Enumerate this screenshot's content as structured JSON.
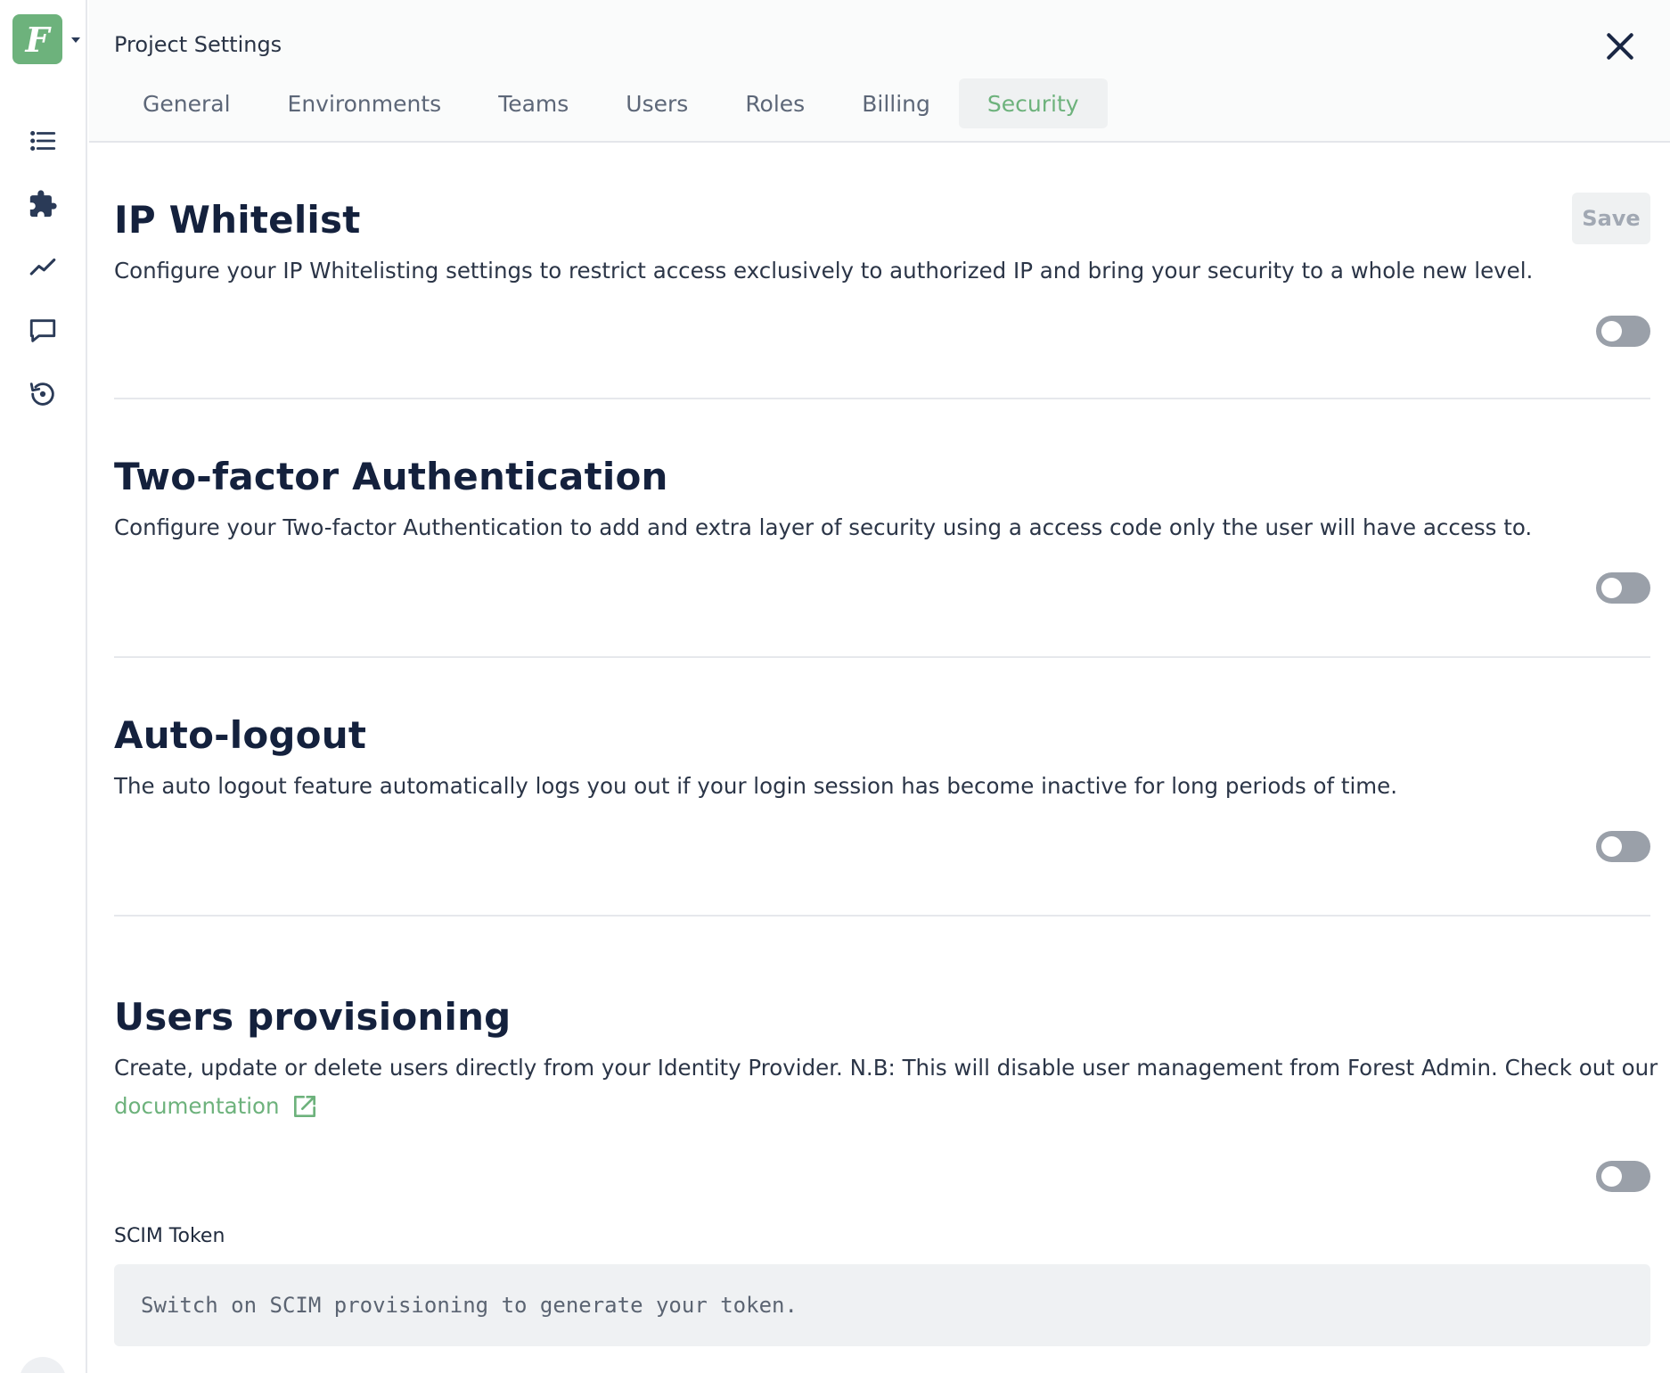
{
  "app": {
    "logo_letter": "F",
    "brand_color": "#6db27c",
    "header_title": "Project Settings"
  },
  "rail": {
    "icons": [
      "list-icon",
      "puzzle-icon",
      "analytics-icon",
      "chat-icon",
      "history-icon"
    ]
  },
  "tabs": [
    {
      "label": "General",
      "active": false
    },
    {
      "label": "Environments",
      "active": false
    },
    {
      "label": "Teams",
      "active": false
    },
    {
      "label": "Users",
      "active": false
    },
    {
      "label": "Roles",
      "active": false
    },
    {
      "label": "Billing",
      "active": false
    },
    {
      "label": "Security",
      "active": true
    }
  ],
  "save_label": "Save",
  "sections": {
    "ip_whitelist": {
      "title": "IP Whitelist",
      "description": "Configure your IP Whitelisting settings to restrict access exclusively to authorized IP and bring your security to a whole new level.",
      "enabled": false
    },
    "two_factor": {
      "title": "Two-factor Authentication",
      "description": "Configure your Two-factor Authentication to add and extra layer of security using a access code only the user will have access to.",
      "enabled": false
    },
    "auto_logout": {
      "title": "Auto-logout",
      "description": "The auto logout feature automatically logs you out if your login session has become inactive for long periods of time.",
      "enabled": false
    },
    "users_provisioning": {
      "title": "Users provisioning",
      "description": "Create, update or delete users directly from your Identity Provider. N.B: This will disable user management from Forest Admin. Check out our",
      "link_label": "documentation",
      "enabled": false,
      "scim_label": "SCIM Token",
      "scim_placeholder": "Switch on SCIM provisioning to generate your token."
    }
  }
}
